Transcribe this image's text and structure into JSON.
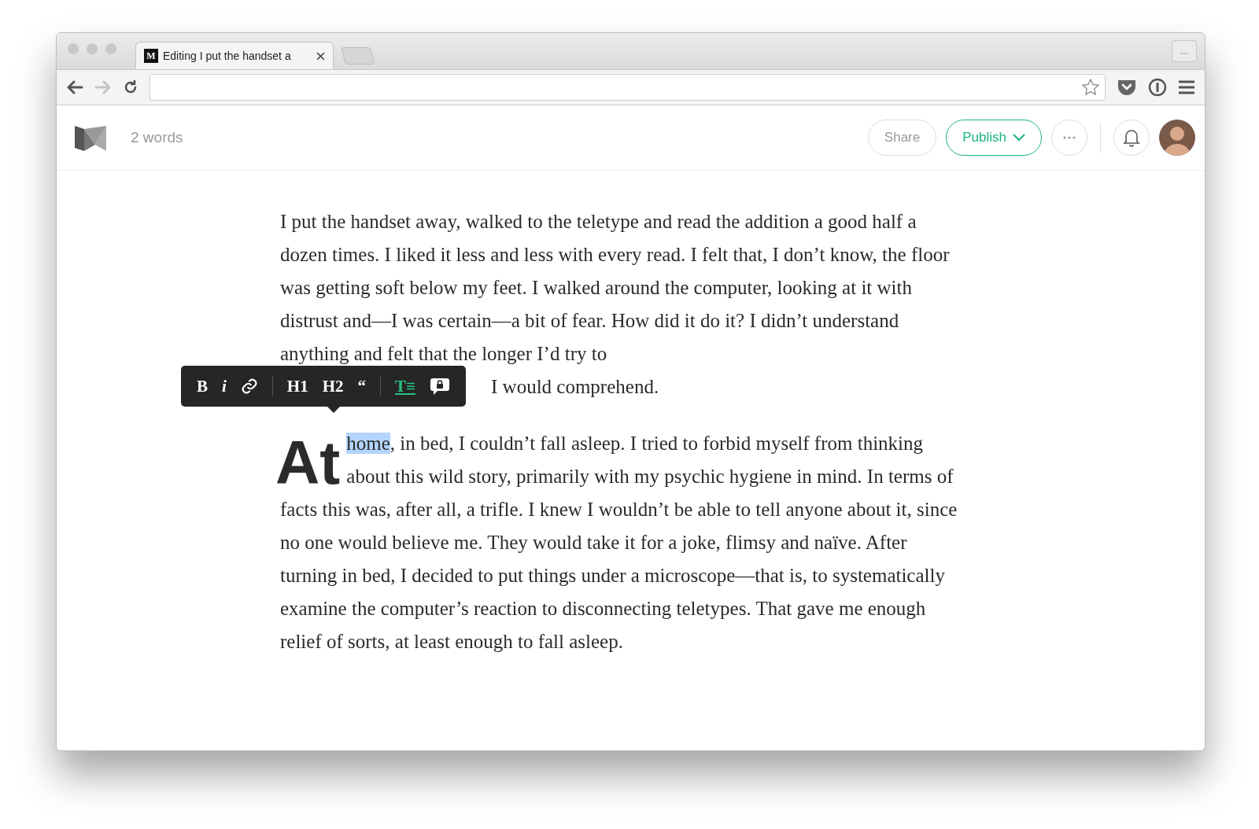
{
  "browser": {
    "tab": {
      "favicon": "M",
      "title": "Editing I put the handset a"
    },
    "overflow": "..."
  },
  "editor": {
    "word_count": "2 words",
    "actions": [
      {
        "kind": "plain",
        "label": "Share"
      },
      {
        "kind": "primary",
        "label": "Publish"
      }
    ]
  },
  "paragraphs": [
    {
      "kind": "plain",
      "text": "I put the handset away, walked to the teletype and read the addition a good half a dozen times. I liked it less and less with every read. I felt that, I don’t know, the floor was getting soft below my feet. I walked around the computer, looking at it with distrust and—I was certain—a bit of fear. How did it do it? I didn’t understand anything and felt that the longer I’d try to",
      "tail": "I would comprehend."
    },
    {
      "kind": "dropcap",
      "drop_cap": "At",
      "selected_word": "home",
      "text": ", in bed, I couldn’t fall asleep. I tried to forbid myself from thinking about this wild story, primarily with my psychic hygiene in mind. In terms of facts this was, after all, a trifle. I knew I wouldn’t be able to tell anyone about it, since no one would believe me. They would take it for a joke, flimsy and naïve. After turning in bed, I decided to put things under a microscope—that is, to systematically examine the computer’s reaction to disconnecting teletypes. That gave me enough relief of sorts, at least enough to fall asleep."
    }
  ],
  "format_toolbar": [
    {
      "kind": "text",
      "label": "B",
      "selected": false
    },
    {
      "kind": "italic",
      "label": "i",
      "selected": false
    },
    {
      "kind": "link",
      "selected": false
    },
    {
      "kind": "separator"
    },
    {
      "kind": "text",
      "label": "H1",
      "selected": false
    },
    {
      "kind": "text",
      "label": "H2",
      "selected": false
    },
    {
      "kind": "text",
      "label": "“",
      "selected": false
    },
    {
      "kind": "separator"
    },
    {
      "kind": "text",
      "label": "T≡",
      "selected": true
    },
    {
      "kind": "comment",
      "selected": false
    }
  ]
}
